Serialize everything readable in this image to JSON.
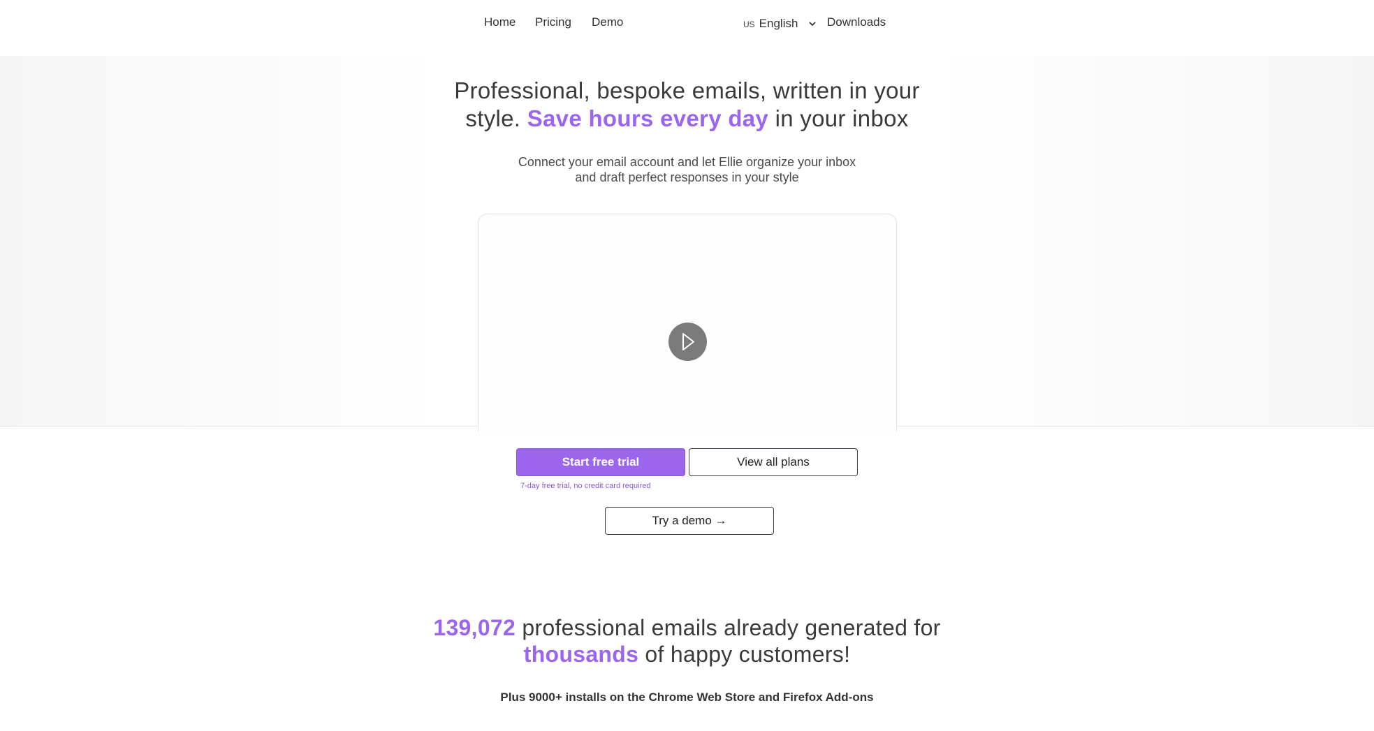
{
  "nav": {
    "home": "Home",
    "pricing": "Pricing",
    "demo": "Demo",
    "language_flag": "US",
    "language_label": "English",
    "downloads": "Downloads"
  },
  "hero": {
    "title_part1": "Professional, bespoke emails, written in your",
    "title_part2": "style.",
    "title_accent": "Save hours every day",
    "title_part3": "in your inbox",
    "subtitle_line1": "Connect your email account and let Ellie organize your inbox",
    "subtitle_line2": "and draft perfect responses in your style"
  },
  "video": {
    "play_icon": "play-icon"
  },
  "cta": {
    "start_trial": "Start free trial",
    "view_plans": "View all plans",
    "trial_note": "7-day free trial, no credit card required",
    "try_demo": "Try a demo →"
  },
  "stats": {
    "count": "139,072",
    "text1": "professional emails already generated for",
    "accent2": "thousands",
    "text2": "of happy customers!",
    "installs": "Plus 9000+ installs on the Chrome Web Store and Firefox Add-ons"
  },
  "colors": {
    "accent": "#9b65ee",
    "text": "#3a3a3a",
    "play_button": "#7b7b7b"
  }
}
